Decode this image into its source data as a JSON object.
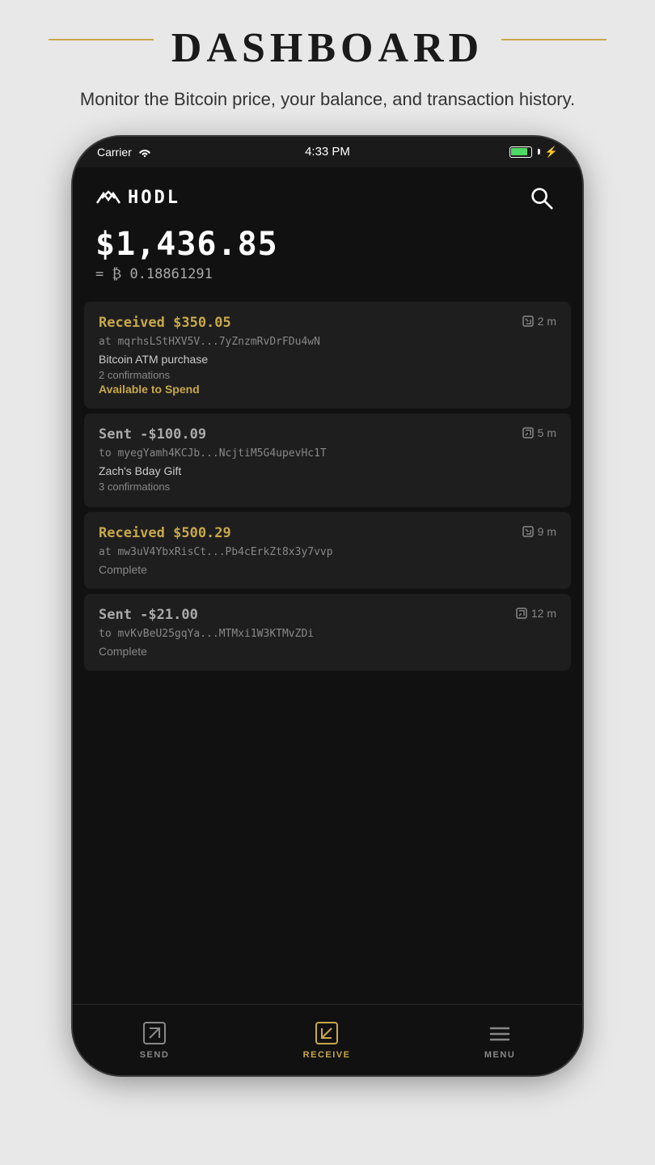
{
  "page": {
    "title": "DASHBOARD",
    "subtitle": "Monitor the Bitcoin price, your balance, and transaction history."
  },
  "status_bar": {
    "carrier": "Carrier",
    "time": "4:33 PM"
  },
  "app": {
    "logo_text": "HODL",
    "balance_usd": "$1,436.85",
    "balance_btc": "= ₿ 0.18861291"
  },
  "transactions": [
    {
      "amount": "Received $350.05",
      "type": "received",
      "time": "2 m",
      "address": "at mqrhsLStHXV5V...7yZnzmRvDrFDu4wN",
      "memo": "Bitcoin ATM purchase",
      "confirmations": "2 confirmations",
      "status": "Available to Spend",
      "status_type": "available"
    },
    {
      "amount": "Sent -$100.09",
      "type": "sent",
      "time": "5 m",
      "address": "to myegYamh4KCJb...NcjtiM5G4upevHc1T",
      "memo": "Zach's Bday Gift",
      "confirmations": "3 confirmations",
      "status": "",
      "status_type": "none"
    },
    {
      "amount": "Received $500.29",
      "type": "received",
      "time": "9 m",
      "address": "at mw3uV4YbxRisCt...Pb4cErkZt8x3y7vvp",
      "memo": "",
      "confirmations": "",
      "status": "Complete",
      "status_type": "complete"
    },
    {
      "amount": "Sent -$21.00",
      "type": "sent",
      "time": "12 m",
      "address": "to mvKvBeU25gqYa...MTMxi1W3KTMvZDi",
      "memo": "",
      "confirmations": "",
      "status": "Complete",
      "status_type": "complete"
    }
  ],
  "nav": {
    "send_label": "SEND",
    "receive_label": "RECEIVE",
    "menu_label": "MENU"
  },
  "colors": {
    "gold": "#c8a84b",
    "white": "#ffffff",
    "dark": "#111111",
    "card_bg": "#1e1e1e"
  }
}
